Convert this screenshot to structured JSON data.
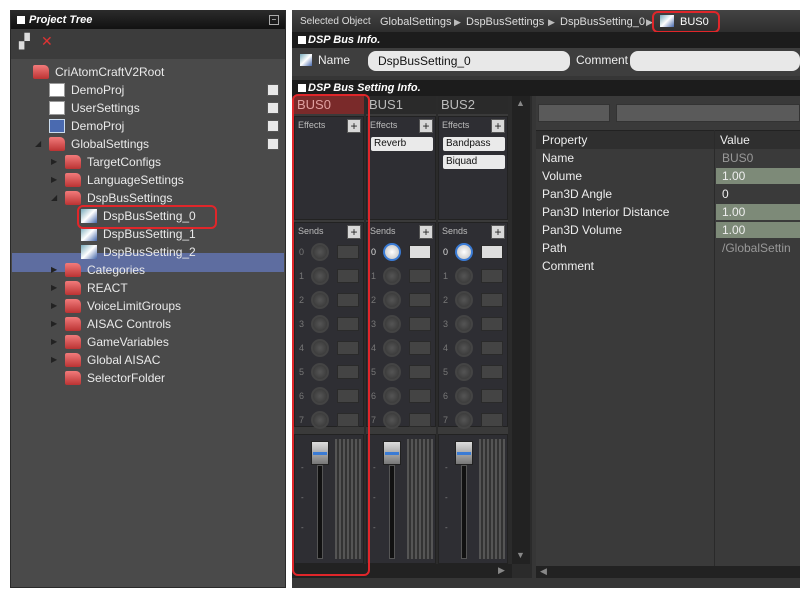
{
  "tree_panel": {
    "title": "Project Tree",
    "nodes": [
      {
        "label": "CriAtomCraftV2Root"
      },
      {
        "label": "DemoProj"
      },
      {
        "label": "UserSettings"
      },
      {
        "label": "DemoProj"
      },
      {
        "label": "GlobalSettings"
      },
      {
        "label": "TargetConfigs"
      },
      {
        "label": "LanguageSettings"
      },
      {
        "label": "DspBusSettings"
      },
      {
        "label": "DspBusSetting_0"
      },
      {
        "label": "DspBusSetting_1"
      },
      {
        "label": "DspBusSetting_2"
      },
      {
        "label": "Categories"
      },
      {
        "label": "REACT"
      },
      {
        "label": "VoiceLimitGroups"
      },
      {
        "label": "AISAC Controls"
      },
      {
        "label": "GameVariables"
      },
      {
        "label": "Global AISAC"
      },
      {
        "label": "SelectorFolder"
      }
    ]
  },
  "breadcrumb": {
    "selected_label": "Selected Object",
    "items": [
      "GlobalSettings",
      "DspBusSettings",
      "DspBusSetting_0",
      "BUS0"
    ]
  },
  "dsp_bus_info": {
    "title": "DSP Bus Info.",
    "name_label": "Name",
    "name_value": "DspBusSetting_0",
    "comment_label": "Comment",
    "comment_value": ""
  },
  "dsp_bus_setting": {
    "title": "DSP Bus Setting Info.",
    "effects_label": "Effects",
    "sends_label": "Sends",
    "send_numbers": [
      "0",
      "1",
      "2",
      "3",
      "4",
      "5",
      "6",
      "7"
    ],
    "buses": [
      {
        "name": "BUS0",
        "effects": []
      },
      {
        "name": "BUS1",
        "effects": [
          "Reverb"
        ]
      },
      {
        "name": "BUS2",
        "effects": [
          "Bandpass",
          "Biquad"
        ]
      }
    ]
  },
  "properties": {
    "header_property": "Property",
    "header_value": "Value",
    "rows": [
      {
        "key": "Name",
        "value": "BUS0"
      },
      {
        "key": "Volume",
        "value": "1.00"
      },
      {
        "key": "Pan3D Angle",
        "value": "0"
      },
      {
        "key": "Pan3D Interior Distance",
        "value": "1.00"
      },
      {
        "key": "Pan3D Volume",
        "value": "1.00"
      },
      {
        "key": "Path",
        "value": "/GlobalSettin"
      },
      {
        "key": "Comment",
        "value": ""
      }
    ]
  },
  "colors": {
    "highlight_box": "#e0262a",
    "selection": "#5e6da0",
    "value_highlight": "#7d8a78"
  }
}
